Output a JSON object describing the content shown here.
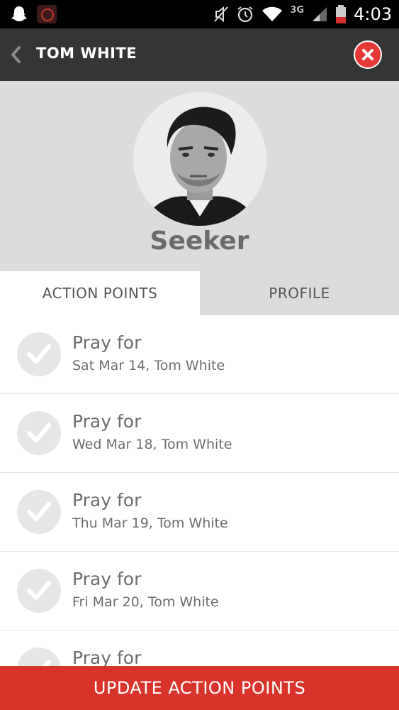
{
  "status_bar": {
    "network_type": "3G",
    "time": "4:03",
    "icons": [
      "snapchat-ghost-icon",
      "app-notification-icon",
      "mute-icon",
      "alarm-icon",
      "wifi-icon",
      "signal-icon",
      "battery-icon"
    ]
  },
  "header": {
    "title": "TOM WHITE",
    "back_icon": "chevron-left-icon",
    "close_icon": "close-icon",
    "close_color": "#e53935"
  },
  "profile": {
    "role": "Seeker",
    "avatar": "avatar-photo"
  },
  "tabs": [
    {
      "label": "ACTION POINTS",
      "active": true
    },
    {
      "label": "PROFILE",
      "active": false
    }
  ],
  "action_points": [
    {
      "title": "Pray for",
      "subtitle": "Sat Mar 14, Tom White"
    },
    {
      "title": "Pray for",
      "subtitle": "Wed Mar 18, Tom White"
    },
    {
      "title": "Pray for",
      "subtitle": "Thu Mar 19, Tom White"
    },
    {
      "title": "Pray for",
      "subtitle": "Fri Mar 20, Tom White"
    },
    {
      "title": "Pray for",
      "subtitle": ""
    }
  ],
  "footer": {
    "update_label": "UPDATE ACTION POINTS",
    "button_color": "#d9342b"
  }
}
